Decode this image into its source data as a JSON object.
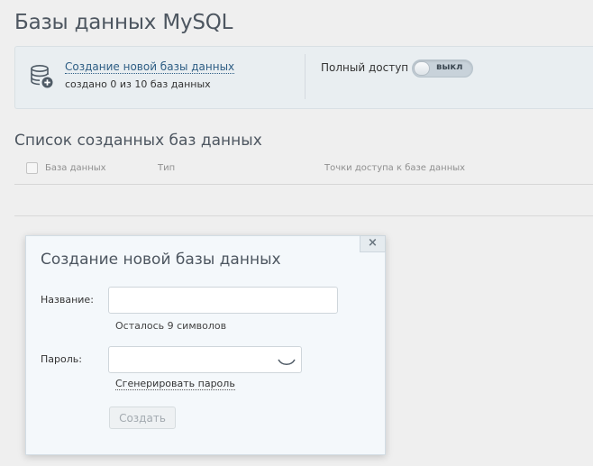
{
  "page": {
    "title": "Базы данных MySQL"
  },
  "info_panel": {
    "create_link": "Создание новой базы данных",
    "created_count": "создано 0 из 10 баз данных",
    "full_access_label": "Полный доступ",
    "toggle_state": "выкл"
  },
  "list": {
    "title": "Список созданных баз данных",
    "columns": [
      "База данных",
      "Тип",
      "Точки доступа к базе данных"
    ]
  },
  "modal": {
    "title": "Создание новой базы данных",
    "close_symbol": "×",
    "name_label": "Название:",
    "name_value": "",
    "name_hint": "Осталось 9 символов",
    "password_label": "Пароль:",
    "password_value": "",
    "generate_link": "Сгенерировать пароль",
    "create_button": "Создать"
  },
  "icons": {
    "database": "database-add-icon",
    "close": "close-icon",
    "show_password": "eye-closed-icon"
  }
}
